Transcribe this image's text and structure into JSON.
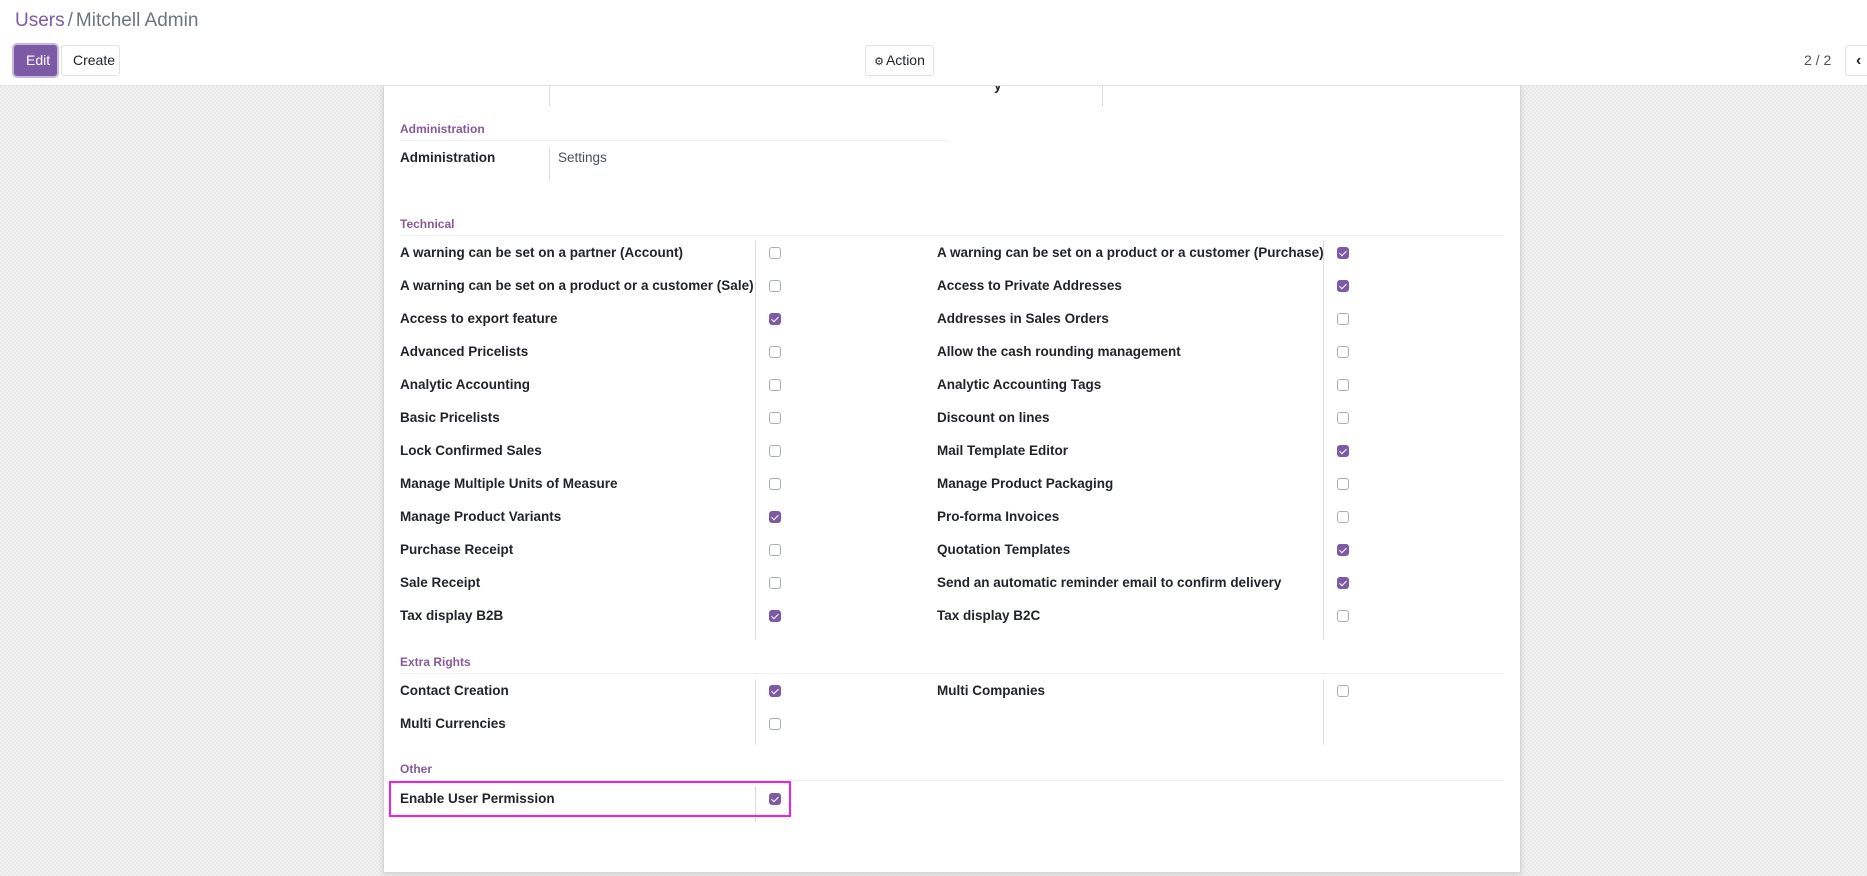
{
  "breadcrumb": {
    "parent": "Users",
    "separator": "/",
    "current": "Mitchell Admin"
  },
  "toolbar": {
    "edit_label": "Edit",
    "create_label": "Create",
    "action_label": "Action",
    "action_icon": "gear-icon"
  },
  "pager": {
    "value": "2 / 2",
    "prev_icon": "chevron-left-icon"
  },
  "form": {
    "top_fragment": "y",
    "administration": {
      "title": "Administration",
      "field_label": "Administration",
      "field_value": "Settings"
    },
    "technical": {
      "title": "Technical",
      "left": [
        {
          "label": "A warning can be set on a partner (Account)",
          "checked": false
        },
        {
          "label": "A warning can be set on a product or a customer (Sale)",
          "checked": false
        },
        {
          "label": "Access to export feature",
          "checked": true
        },
        {
          "label": "Advanced Pricelists",
          "checked": false
        },
        {
          "label": "Analytic Accounting",
          "checked": false
        },
        {
          "label": "Basic Pricelists",
          "checked": false
        },
        {
          "label": "Lock Confirmed Sales",
          "checked": false
        },
        {
          "label": "Manage Multiple Units of Measure",
          "checked": false
        },
        {
          "label": "Manage Product Variants",
          "checked": true
        },
        {
          "label": "Purchase Receipt",
          "checked": false
        },
        {
          "label": "Sale Receipt",
          "checked": false
        },
        {
          "label": "Tax display B2B",
          "checked": true
        }
      ],
      "right": [
        {
          "label": "A warning can be set on a product or a customer (Purchase)",
          "checked": true
        },
        {
          "label": "Access to Private Addresses",
          "checked": true
        },
        {
          "label": "Addresses in Sales Orders",
          "checked": false
        },
        {
          "label": "Allow the cash rounding management",
          "checked": false
        },
        {
          "label": "Analytic Accounting Tags",
          "checked": false
        },
        {
          "label": "Discount on lines",
          "checked": false
        },
        {
          "label": "Mail Template Editor",
          "checked": true
        },
        {
          "label": "Manage Product Packaging",
          "checked": false
        },
        {
          "label": "Pro-forma Invoices",
          "checked": false
        },
        {
          "label": "Quotation Templates",
          "checked": true
        },
        {
          "label": "Send an automatic reminder email to confirm delivery",
          "checked": true
        },
        {
          "label": "Tax display B2C",
          "checked": false
        }
      ]
    },
    "extra_rights": {
      "title": "Extra Rights",
      "left": [
        {
          "label": "Contact Creation",
          "checked": true
        },
        {
          "label": "Multi Currencies",
          "checked": false
        }
      ],
      "right": [
        {
          "label": "Multi Companies",
          "checked": false
        }
      ]
    },
    "other": {
      "title": "Other",
      "left": [
        {
          "label": "Enable User Permission",
          "checked": true
        }
      ]
    }
  },
  "colors": {
    "brand": "#7c5aa6",
    "group_title": "#875a9b",
    "highlight": "#ee1ee6"
  }
}
